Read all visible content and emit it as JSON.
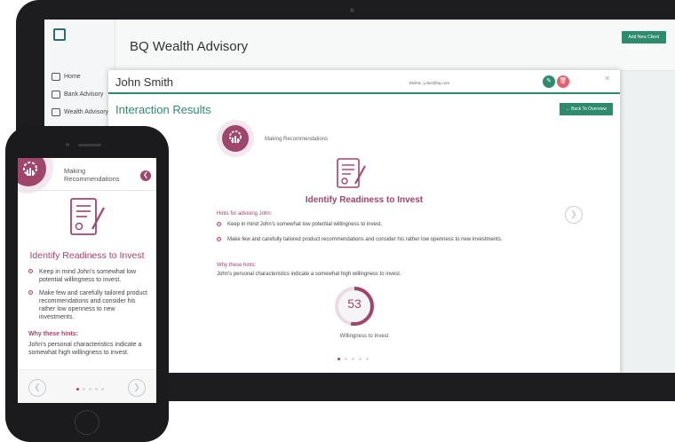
{
  "app": {
    "title": "BQ Wealth Advisory",
    "add_client_label": "Add New Client",
    "nav": [
      {
        "label": "Home",
        "icon": "home-icon"
      },
      {
        "label": "Bank Advisory",
        "icon": "bank-icon"
      },
      {
        "label": "Wealth Advisory",
        "icon": "wealth-icon"
      }
    ]
  },
  "modal": {
    "client_name": "John Smith",
    "email": "EMAIL: j.doe@bq.com",
    "section_title": "Interaction Results",
    "back_label": "← Back To Overview",
    "step_label": "Making Recommendations",
    "rec_title": "Identify Readiness to Invest",
    "hints_heading": "Hints for advising John:",
    "hints": [
      "Keep in mind John's somewhat low potential willingness to invest.",
      "Make few and carefully tailored product recommendations and consider his rather low openness to new investments."
    ],
    "why_heading": "Why these hints:",
    "why_text": "John's personal characteristics indicate a somewhat high willingness to invest.",
    "gauge_value": "53",
    "gauge_fraction": 0.53,
    "gauge_label": "Willingness to Invest",
    "page_dots": 5,
    "active_dot": 0
  },
  "phone": {
    "step_label": "Making Recommendations",
    "rec_title": "Identify Readiness to Invest",
    "hints": [
      "Keep in mind John's somewhat low potential willingness to invest.",
      "Make few and carefully tailored product recommendations and consider his rather low openness to new investments."
    ],
    "why_heading": "Why these hints:",
    "why_text": "John's personal characteristics indicate a somewhat high willingness to invest."
  },
  "colors": {
    "accent": "#2e8b6e",
    "brand": "#a0456b"
  }
}
